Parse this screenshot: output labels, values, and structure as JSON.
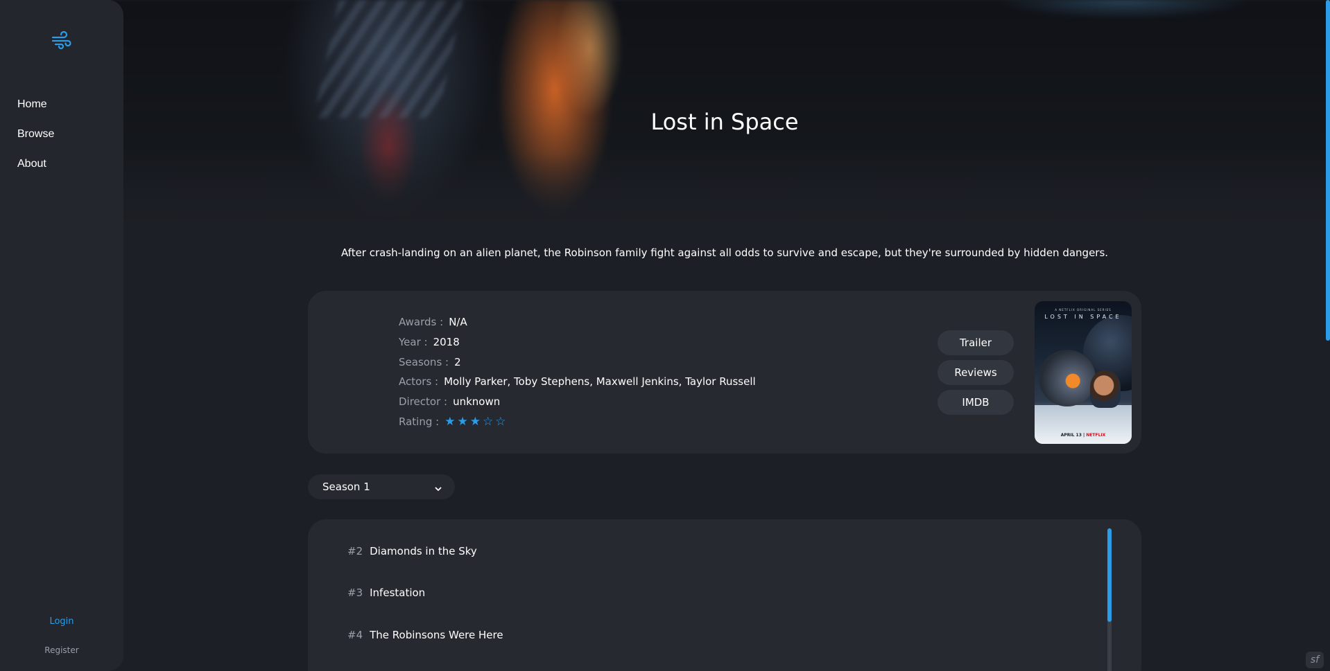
{
  "sidebar": {
    "logo_icon": "wind-icon",
    "nav": [
      {
        "label": "Home"
      },
      {
        "label": "Browse"
      },
      {
        "label": "About"
      }
    ],
    "login_label": "Login",
    "register_label": "Register"
  },
  "show": {
    "title": "Lost in Space",
    "description": "After crash-landing on an alien planet, the Robinson family fight against all odds to survive and escape, but they're surrounded by hidden dangers.",
    "details": [
      {
        "label": "Awards :",
        "value": "N/A"
      },
      {
        "label": "Year :",
        "value": "2018"
      },
      {
        "label": "Seasons :",
        "value": "2"
      },
      {
        "label": "Actors :",
        "value": "Molly Parker, Toby Stephens, Maxwell Jenkins, Taylor Russell"
      },
      {
        "label": "Director :",
        "value": "unknown"
      }
    ],
    "rating_label": "Rating :",
    "rating": {
      "value": 3,
      "max": 5
    },
    "actions": [
      {
        "label": "Trailer"
      },
      {
        "label": "Reviews"
      },
      {
        "label": "IMDB"
      }
    ],
    "poster": {
      "tagline_top": "A NETFLIX ORIGINAL SERIES",
      "title_text": "LOST IN SPACE",
      "date_text": "APRIL 13",
      "brand_text": "NETFLIX"
    }
  },
  "seasons": {
    "selected": "Season 1"
  },
  "episodes": [
    {
      "number": "#2",
      "title": "Diamonds in the Sky"
    },
    {
      "number": "#3",
      "title": "Infestation"
    },
    {
      "number": "#4",
      "title": "The Robinsons Were Here"
    }
  ],
  "colors": {
    "accent": "#2b9de8",
    "background": "#1c1f25",
    "card": "#262930",
    "sidebar": "#23262d"
  }
}
